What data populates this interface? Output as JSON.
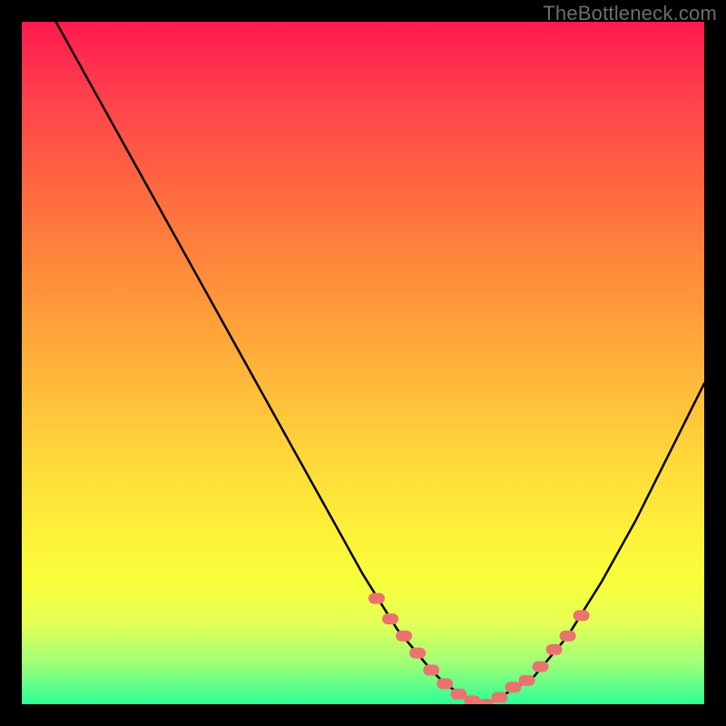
{
  "watermark": "TheBottleneck.com",
  "chart_data": {
    "type": "line",
    "title": "",
    "xlabel": "",
    "ylabel": "",
    "xlim": [
      0,
      100
    ],
    "ylim": [
      0,
      100
    ],
    "series": [
      {
        "name": "bottleneck-curve",
        "x": [
          5,
          10,
          15,
          20,
          25,
          30,
          35,
          40,
          45,
          50,
          55,
          60,
          62,
          65,
          68,
          70,
          75,
          80,
          85,
          90,
          95,
          100
        ],
        "y": [
          100,
          91,
          82,
          73,
          64,
          55,
          46,
          37,
          28,
          19,
          11,
          5,
          3,
          1,
          0,
          1,
          4,
          10,
          18,
          27,
          37,
          47
        ]
      }
    ],
    "markers": {
      "name": "highlight-dots",
      "color": "#e9746f",
      "x": [
        52,
        54,
        56,
        58,
        60,
        62,
        64,
        66,
        68,
        70,
        72,
        74,
        76,
        78,
        80,
        82
      ],
      "y": [
        15.5,
        12.5,
        10.0,
        7.5,
        5.0,
        3.0,
        1.5,
        0.5,
        0.0,
        1.0,
        2.5,
        3.5,
        5.5,
        8.0,
        10.0,
        13.0
      ]
    },
    "colors": {
      "curve": "#000000",
      "marker": "#e9746f",
      "gradient_top": "#ff1a4d",
      "gradient_bottom": "#2dff96"
    }
  }
}
